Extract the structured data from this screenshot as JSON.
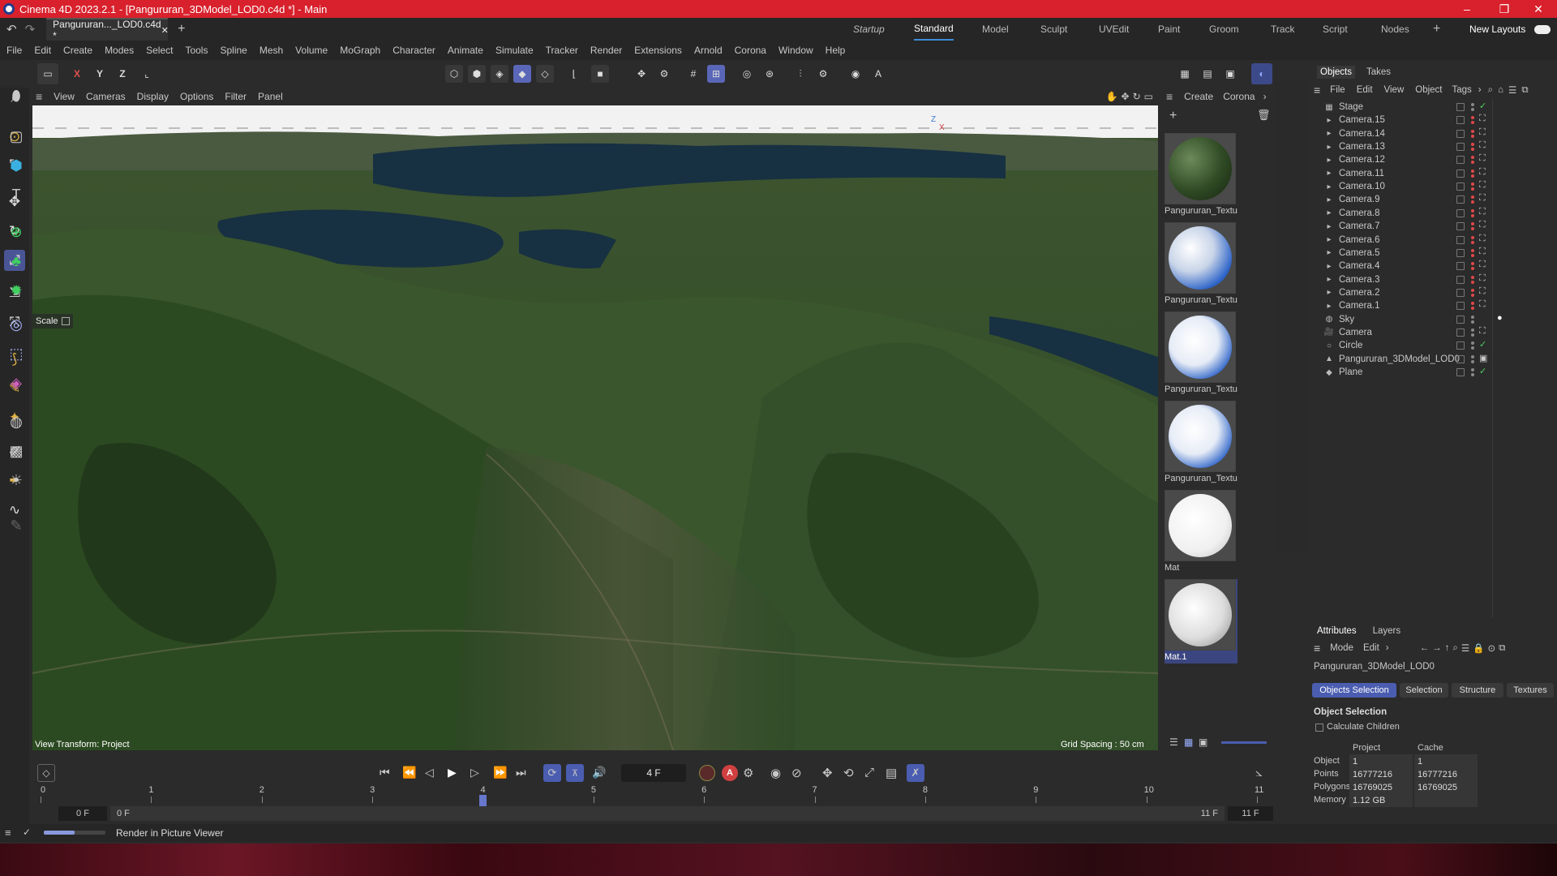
{
  "window": {
    "title": "Cinema 4D 2023.2.1 - [Pangururan_3DModel_LOD0.c4d *] - Main",
    "min": "–",
    "max": "❐",
    "close": "✕"
  },
  "tabs": {
    "doc": "Pangururan..._LOD0.c4d *",
    "close": "✕",
    "add": "+"
  },
  "layouts": [
    "Startup",
    "Standard",
    "Model",
    "Sculpt",
    "UVEdit",
    "Paint",
    "Groom",
    "Track",
    "Script",
    "Nodes"
  ],
  "new_layouts": "New Layouts",
  "menu": [
    "File",
    "Edit",
    "Create",
    "Modes",
    "Select",
    "Tools",
    "Spline",
    "Mesh",
    "Volume",
    "MoGraph",
    "Character",
    "Animate",
    "Simulate",
    "Tracker",
    "Render",
    "Extensions",
    "Arnold",
    "Corona",
    "Window",
    "Help"
  ],
  "axis": {
    "x": "X",
    "y": "Y",
    "z": "Z"
  },
  "viewport": {
    "menu": [
      "View",
      "Cameras",
      "Display",
      "Options",
      "Filter",
      "Panel"
    ],
    "scale_label": "Scale",
    "view_transform": "View Transform: Project",
    "grid_spacing": "Grid Spacing : 50 cm",
    "gizmo_z": "Z",
    "gizmo_x": "X"
  },
  "materials": {
    "menu": [
      "Create",
      "Corona"
    ],
    "items": [
      "Pangururan_Textu",
      "Pangururan_Textu",
      "Pangururan_Textu",
      "Pangururan_Textu",
      "Mat",
      "Mat.1"
    ]
  },
  "objects": {
    "tabs": [
      "Objects",
      "Takes"
    ],
    "menu": [
      "File",
      "Edit",
      "View",
      "Object",
      "Tags"
    ],
    "rows": [
      "Stage",
      "Camera.15",
      "Camera.14",
      "Camera.13",
      "Camera.12",
      "Camera.11",
      "Camera.10",
      "Camera.9",
      "Camera.8",
      "Camera.7",
      "Camera.6",
      "Camera.5",
      "Camera.4",
      "Camera.3",
      "Camera.2",
      "Camera.1",
      "Sky",
      "Camera",
      "Circle",
      "Pangururan_3DModel_LOD0",
      "Plane"
    ]
  },
  "attributes": {
    "tabs": [
      "Attributes",
      "Layers"
    ],
    "menu": [
      "Mode",
      "Edit"
    ],
    "object_name": "Pangururan_3DModel_LOD0",
    "buttons": [
      "Objects Selection",
      "Selection",
      "Structure",
      "Textures"
    ],
    "section": "Object Selection",
    "calc_children": "Calculate Children",
    "col_project": "Project",
    "col_cache": "Cache",
    "rows": [
      {
        "label": "Object",
        "project": "1",
        "cache": "1"
      },
      {
        "label": "Points",
        "project": "16777216",
        "cache": "16777216"
      },
      {
        "label": "Polygons",
        "project": "16769025",
        "cache": "16769025"
      },
      {
        "label": "Memory",
        "project": "1.12 GB",
        "cache": ""
      }
    ]
  },
  "timeline": {
    "frame": "4 F",
    "ticks": [
      "0",
      "1",
      "2",
      "3",
      "4",
      "5",
      "6",
      "7",
      "8",
      "9",
      "10",
      "11"
    ],
    "start": "0 F",
    "start2": "0 F",
    "end": "11 F",
    "end2": "11 F",
    "current": 4,
    "max": 11
  },
  "status": {
    "text": "Render in Picture Viewer",
    "progress": 0.5
  }
}
